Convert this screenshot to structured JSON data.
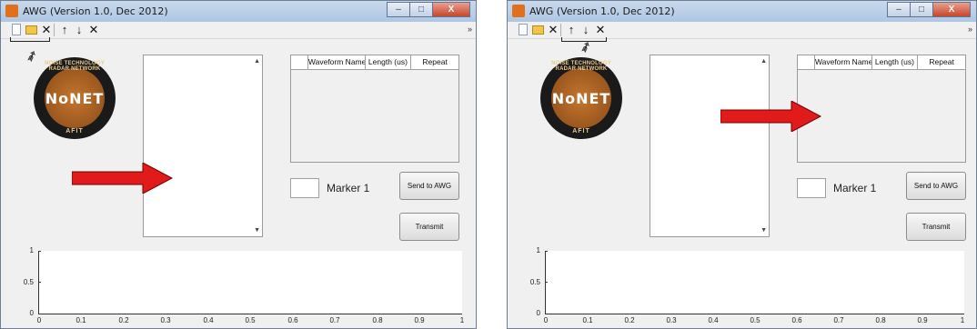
{
  "panels": [
    {
      "window": {
        "title": "AWG (Version 1.0, Dec 2012)",
        "obscured_title": "...",
        "buttons": {
          "minimize": "–",
          "maximize": "□",
          "close": "X"
        }
      },
      "toolbar": {
        "delete": "✕",
        "up": "↑",
        "down": "↓",
        "close": "✕",
        "overflow": "»"
      },
      "logo": {
        "name": "NoNET",
        "arc_text": "NOISE TECHNOLOGY RADAR NETWORK",
        "bottom_text": "AFIT"
      },
      "table": {
        "headers": [
          "",
          "Waveform Name",
          "Length (us)",
          "Repeat"
        ]
      },
      "marker": {
        "label": "Marker 1"
      },
      "buttons": {
        "send": "Send to AWG",
        "transmit": "Transmit"
      },
      "plot": {
        "yticks": [
          "1",
          "0.5",
          "0"
        ],
        "xticks": [
          "0",
          "0.1",
          "0.2",
          "0.3",
          "0.4",
          "0.5",
          "0.6",
          "0.7",
          "0.8",
          "0.9",
          "1"
        ]
      },
      "annotation": {
        "arrow_points_to": "waveform list",
        "bracket_on": "new and open icons"
      }
    },
    {
      "window": {
        "title": "AWG (Version 1.0, Dec 2012)",
        "obscured_title": "...",
        "buttons": {
          "minimize": "–",
          "maximize": "□",
          "close": "X"
        }
      },
      "toolbar": {
        "delete": "✕",
        "up": "↑",
        "down": "↓",
        "close": "✕",
        "overflow": "»"
      },
      "logo": {
        "name": "NoNET",
        "arc_text": "NOISE TECHNOLOGY RADAR NETWORK",
        "bottom_text": "AFIT"
      },
      "table": {
        "headers": [
          "",
          "Waveform Name",
          "Length (us)",
          "Repeat"
        ]
      },
      "marker": {
        "label": "Marker 1"
      },
      "buttons": {
        "send": "Send to AWG",
        "transmit": "Transmit"
      },
      "plot": {
        "yticks": [
          "1",
          "0.5",
          "0"
        ],
        "xticks": [
          "0",
          "0.1",
          "0.2",
          "0.3",
          "0.4",
          "0.5",
          "0.6",
          "0.7",
          "0.8",
          "0.9",
          "1"
        ]
      },
      "annotation": {
        "arrow_points_to": "waveform table",
        "bracket_on": "up down delete icons"
      }
    }
  ],
  "colors": {
    "arrow": "#e11a1a",
    "logo_copper": "#a8602a",
    "titlebar": "#bcd0e8"
  }
}
